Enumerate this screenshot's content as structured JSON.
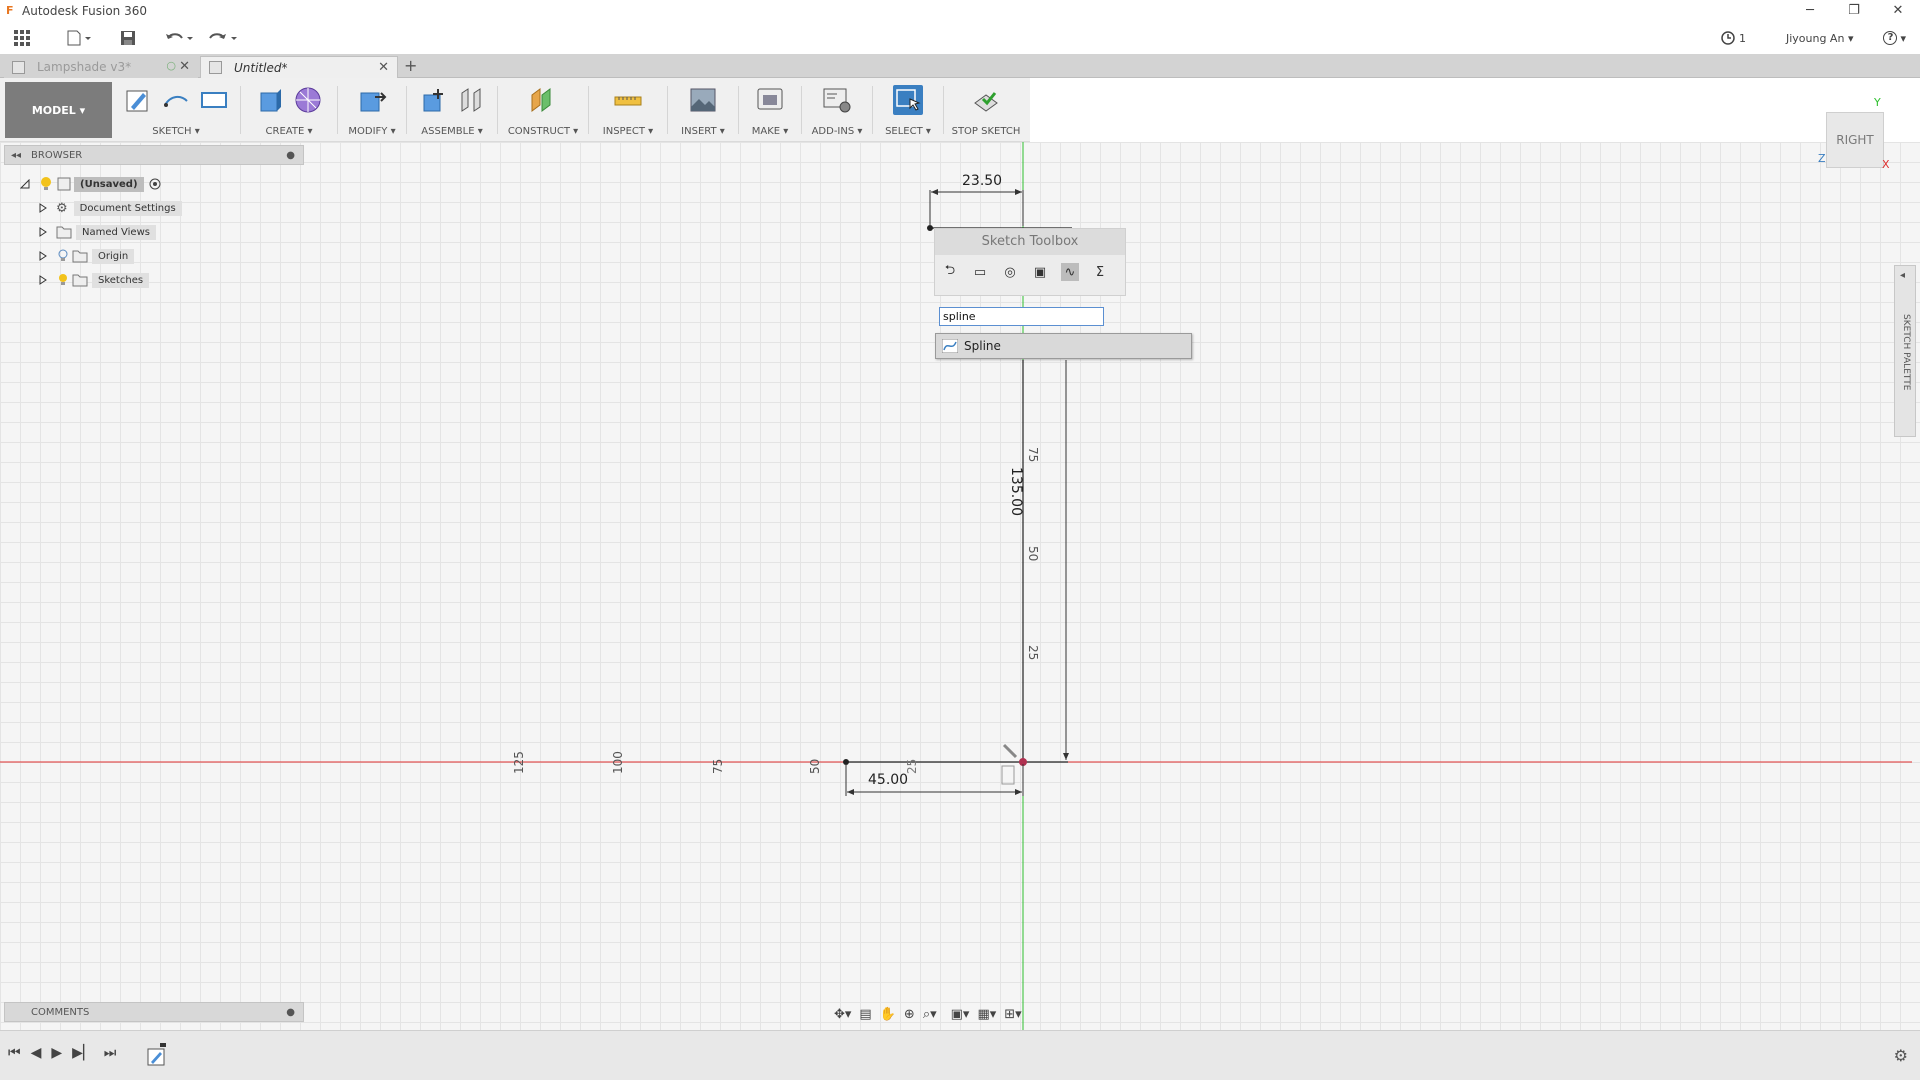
{
  "window": {
    "title": "Autodesk Fusion 360",
    "logo": "F",
    "minimize": "─",
    "restore": "❐",
    "close": "✕"
  },
  "quick_access": {
    "jobs_count": "1",
    "user": "Jiyoung An",
    "help": "?"
  },
  "tabs": [
    {
      "label": "Lampshade v3*",
      "state": "inactive"
    },
    {
      "label": "Untitled*",
      "state": "active"
    }
  ],
  "toolbar": {
    "workspace": "MODEL",
    "groups": [
      "SKETCH",
      "CREATE",
      "MODIFY",
      "ASSEMBLE",
      "CONSTRUCT",
      "INSPECT",
      "INSERT",
      "MAKE",
      "ADD-INS",
      "SELECT",
      "STOP SKETCH"
    ]
  },
  "browser": {
    "title": "BROWSER",
    "items": [
      {
        "label": "(Unsaved)",
        "icon": "lightbulb-icon"
      },
      {
        "label": "Document Settings",
        "icon": "gear-icon"
      },
      {
        "label": "Named Views",
        "icon": "folder-icon"
      },
      {
        "label": "Origin",
        "icon": "folder-icon"
      },
      {
        "label": "Sketches",
        "icon": "folder-icon"
      }
    ]
  },
  "sketch_toolbox": {
    "title": "Sketch Toolbox",
    "search_value": "spline",
    "result": "Spline"
  },
  "viewcube": {
    "face": "RIGHT",
    "axis_y": "Y",
    "axis_z": "Z",
    "axis_x": "X"
  },
  "palette": {
    "label": "SKETCH PALETTE"
  },
  "comments": {
    "title": "COMMENTS"
  },
  "dimensions": {
    "top_width": "23.50",
    "height": "135.00",
    "bottom_width": "45.00"
  },
  "ruler_labels": {
    "horizontal": [
      "125",
      "100",
      "75",
      "50",
      "25"
    ],
    "vertical": [
      "75",
      "50",
      "25"
    ]
  },
  "colors": {
    "x_axis": "#e03030",
    "y_axis": "#2ec02e",
    "select_active": "#3a7fc1",
    "model_button": "#7c7c7c"
  }
}
